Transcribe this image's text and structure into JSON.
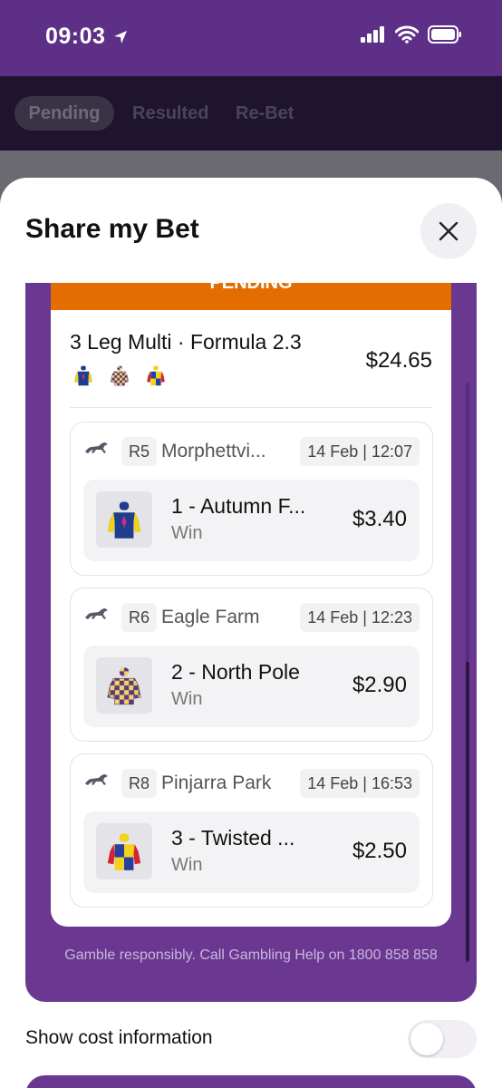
{
  "status_bar": {
    "time": "09:03"
  },
  "background": {
    "tabs": [
      "Pending",
      "Resulted",
      "Re-Bet"
    ]
  },
  "sheet": {
    "title": "Share my Bet",
    "banner_text": "PENDING",
    "bet": {
      "title": "3 Leg Multi · Formula 2.3",
      "price": "$24.65",
      "legs": [
        {
          "race": "R5",
          "track": "Morphettvi...",
          "date": "14 Feb",
          "time": "12:07",
          "selection": "1 - Autumn F...",
          "bet_type": "Win",
          "price": "$3.40",
          "silk": "blue-fleur-silk"
        },
        {
          "race": "R6",
          "track": "Eagle Farm",
          "date": "14 Feb",
          "time": "12:23",
          "selection": "2 - North Pole",
          "bet_type": "Win",
          "price": "$2.90",
          "silk": "checked-silk"
        },
        {
          "race": "R8",
          "track": "Pinjarra Park",
          "date": "14 Feb",
          "time": "16:53",
          "selection": "3 - Twisted ...",
          "bet_type": "Win",
          "price": "$2.50",
          "silk": "quartered-silk"
        }
      ]
    },
    "gamble_text": "Gamble responsibly. Call Gambling Help on 1800 858 858",
    "cost_label": "Show cost information",
    "cost_toggle_on": false
  },
  "colors": {
    "brand_purple": "#6b3891",
    "status_orange": "#e36d00"
  }
}
